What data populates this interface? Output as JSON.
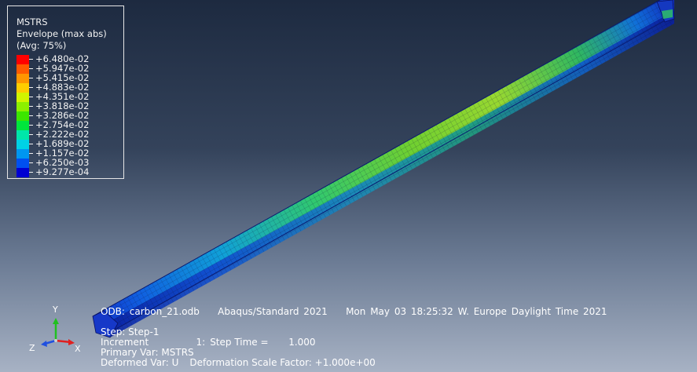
{
  "legend": {
    "variable": "MSTRS",
    "envelope": "Envelope (max abs)",
    "averaging": "(Avg: 75%)",
    "entries": [
      {
        "value": "+6.480e-02",
        "color": "#ff0000"
      },
      {
        "value": "+5.947e-02",
        "color": "#ff5a00"
      },
      {
        "value": "+5.415e-02",
        "color": "#ff9600"
      },
      {
        "value": "+4.883e-02",
        "color": "#ffcd00"
      },
      {
        "value": "+4.351e-02",
        "color": "#d2f500"
      },
      {
        "value": "+3.818e-02",
        "color": "#8cf000"
      },
      {
        "value": "+3.286e-02",
        "color": "#3ce600"
      },
      {
        "value": "+2.754e-02",
        "color": "#00e63c"
      },
      {
        "value": "+2.222e-02",
        "color": "#00e6aa"
      },
      {
        "value": "+1.689e-02",
        "color": "#00d2e6"
      },
      {
        "value": "+1.157e-02",
        "color": "#0096f0"
      },
      {
        "value": "+6.250e-03",
        "color": "#0050f0"
      },
      {
        "value": "+9.277e-04",
        "color": "#0000d2"
      }
    ]
  },
  "info": {
    "odb": "ODB: carbon_21.odb",
    "solver": "Abaqus/Standard 2021",
    "timestamp": "Mon May 03 18:25:32 W. Europe Daylight Time 2021",
    "step": "Step: Step-1",
    "increment_label": "Increment",
    "increment_value": "1:",
    "step_time_label": "Step Time =",
    "step_time_value": "1.000",
    "primary_var": "Primary Var: MSTRS",
    "deformed_var": "Deformed Var: U",
    "deformation_scale": "Deformation Scale Factor: +1.000e+00"
  },
  "triad": {
    "x": "X",
    "y": "Y",
    "z": "Z"
  }
}
